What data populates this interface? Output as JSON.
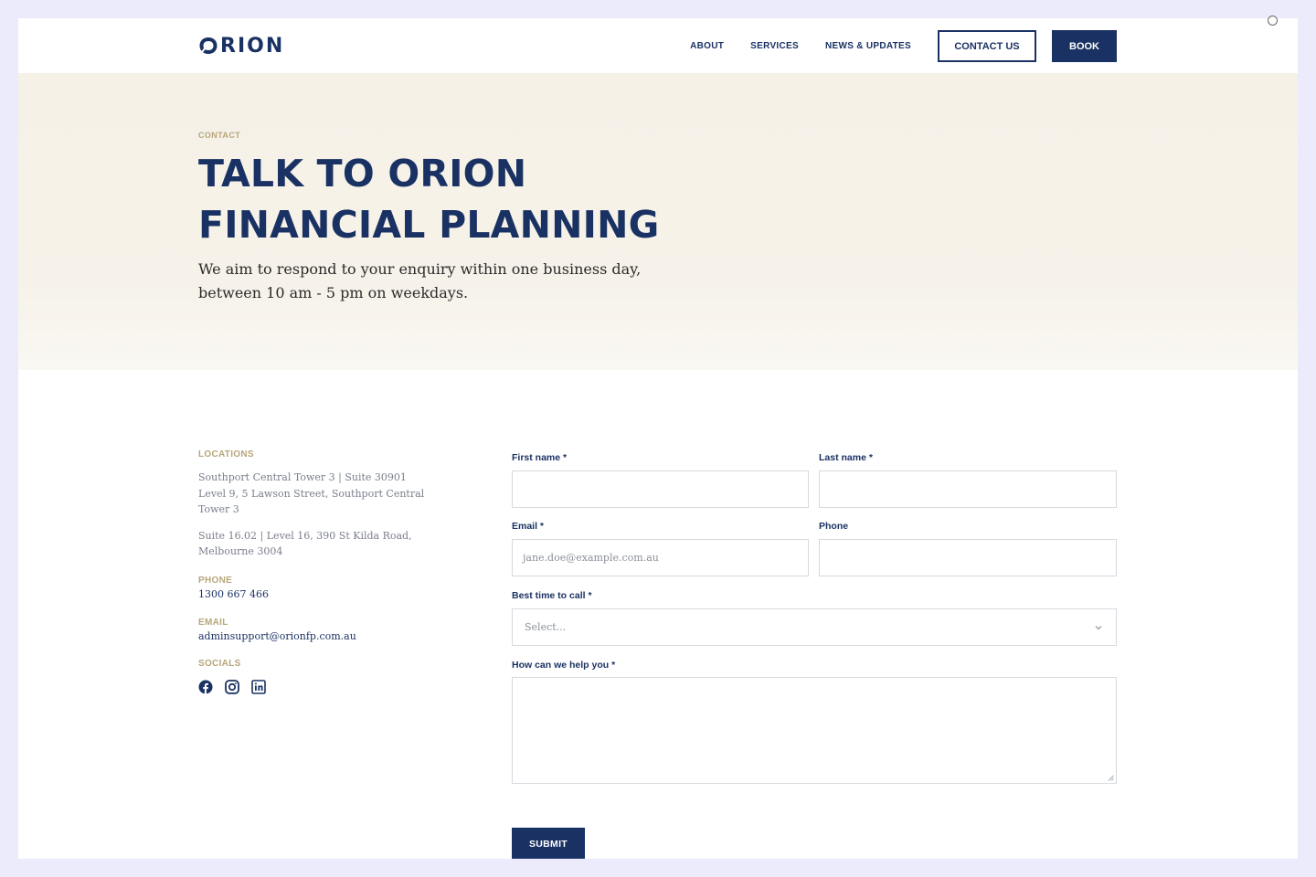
{
  "brand": {
    "logo_text": "RION",
    "logo_initial_icon": "orion-o-mark-icon"
  },
  "nav": {
    "links": [
      "ABOUT",
      "SERVICES",
      "NEWS & UPDATES"
    ],
    "contact_button": "CONTACT US",
    "book_button": "BOOK"
  },
  "hero": {
    "eyebrow": "CONTACT",
    "title_line1": "TALK TO ORION",
    "title_line2": "FINANCIAL PLANNING",
    "subtitle": "We aim to respond to your enquiry within one business day, between 10 am - 5 pm on weekdays."
  },
  "info": {
    "locations_label": "LOCATIONS",
    "location1": "Southport Central Tower 3 | Suite 30901 Level 9, 5 Lawson Street, Southport Central Tower 3",
    "location2": "Suite 16.02 | Level 16, 390 St Kilda Road, Melbourne 3004",
    "phone_label": "PHONE",
    "phone": "1300 667 466",
    "email_label": "EMAIL",
    "email": "adminsupport@orionfp.com.au",
    "socials_label": "SOCIALS",
    "social_icons": [
      "facebook-icon",
      "instagram-icon",
      "linkedin-icon"
    ]
  },
  "form": {
    "first_name_label": "First name *",
    "last_name_label": "Last name *",
    "email_label": "Email *",
    "email_placeholder": "jane.doe@example.com.au",
    "phone_label": "Phone",
    "best_time_label": "Best time to call *",
    "best_time_selected": "Select...",
    "help_label": "How can we help you *",
    "submit_label": "SUBMIT"
  },
  "colors": {
    "navy": "#1a3263",
    "gold": "#b8a67a",
    "hero_bg": "#f5f1e7",
    "frame_bg": "#ecebfc"
  }
}
